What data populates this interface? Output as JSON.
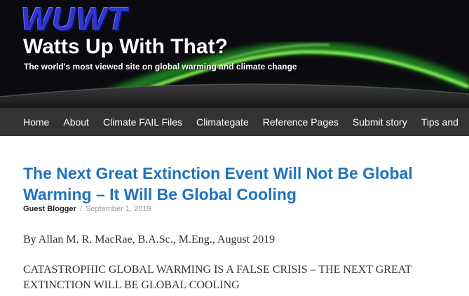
{
  "header": {
    "logo_text": "WUWT",
    "site_title": "Watts Up With That?",
    "tagline": "The world's most viewed site on global warming and climate change"
  },
  "nav": {
    "items": [
      {
        "label": "Home"
      },
      {
        "label": "About"
      },
      {
        "label": "Climate FAIL Files"
      },
      {
        "label": "Climategate"
      },
      {
        "label": "Reference Pages"
      },
      {
        "label": "Submit story"
      },
      {
        "label": "Tips and"
      }
    ]
  },
  "article": {
    "title": "The Next Great Extinction Event Will Not Be Global Warming – It Will Be Global Cooling",
    "author": "Guest Blogger",
    "separator": "/",
    "date": "September 1, 2019",
    "byline": "By Allan M. R. MacRae, B.A.Sc., M.Eng., August 2019",
    "lead": "CATASTROPHIC GLOBAL WARMING IS A FALSE CRISIS – THE NEXT GREAT EXTINCTION WILL BE GLOBAL COOLING"
  },
  "colors": {
    "title_blue": "#1e73be",
    "nav_bg": "#333333",
    "logo_blue": "#2f36c9",
    "aurora_green": "#4cff3a"
  }
}
